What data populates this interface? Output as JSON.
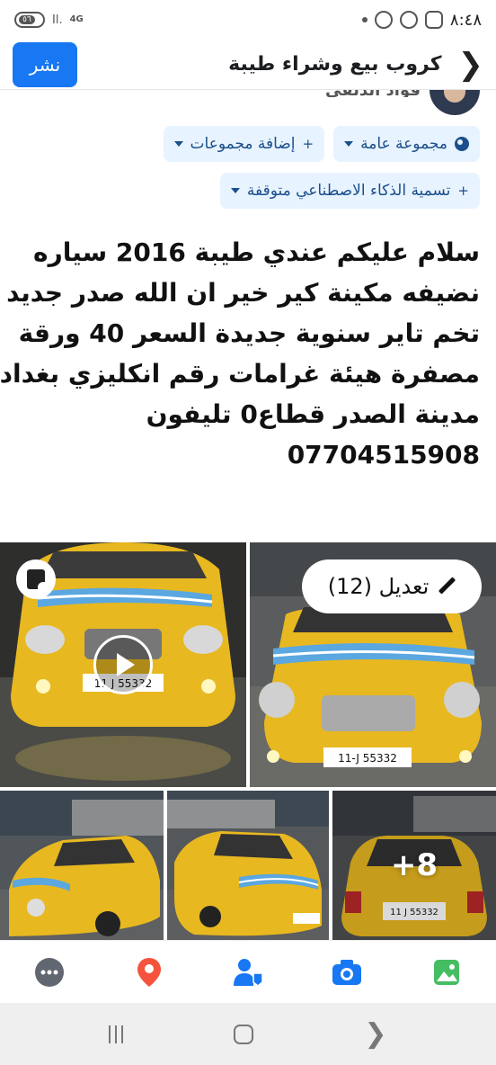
{
  "status_bar": {
    "time": "٨:٤٨",
    "battery": "٥٦",
    "network": "4G",
    "signal": "Il."
  },
  "header": {
    "title": "كروب بيع وشراء طيبة",
    "post_label": "نشر"
  },
  "author": {
    "name": "فؤاد الدلفي"
  },
  "chips": {
    "audience": "مجموعة عامة",
    "add_groups": "إضافة مجموعات",
    "ai_label": "تسمية الذكاء الاصطناعي متوقفة"
  },
  "post": {
    "lines": [
      "سلام عليكم عندي طيبة 2016 سياره",
      "نضيفه مكينة كير خير ان الله صدر جديد",
      "تخم تاير سنوية جديدة السعر 40 ورقة",
      "مصفرة هيئة غرامات رقم انكليزي بغداد",
      "مدينة الصدر قطاع0 تليفون",
      "07704515908"
    ]
  },
  "media": {
    "edit_label": "تعديل (12)",
    "more_count": "+8",
    "plate_1": "11 J 55332",
    "plate_2": "11-J 55332",
    "plate_3": "11 J 55332"
  },
  "actions": [
    {
      "name": "more",
      "color": "#606770"
    },
    {
      "name": "location",
      "color": "#f5533d"
    },
    {
      "name": "tag-people",
      "color": "#1877f2"
    },
    {
      "name": "camera",
      "color": "#1877f2"
    },
    {
      "name": "photo",
      "color": "#45bd62"
    }
  ],
  "colors": {
    "brand": "#1877f2",
    "chip_bg": "#e7f3ff",
    "chip_text": "#1b4f8a",
    "car_yellow": "#e8b820"
  }
}
